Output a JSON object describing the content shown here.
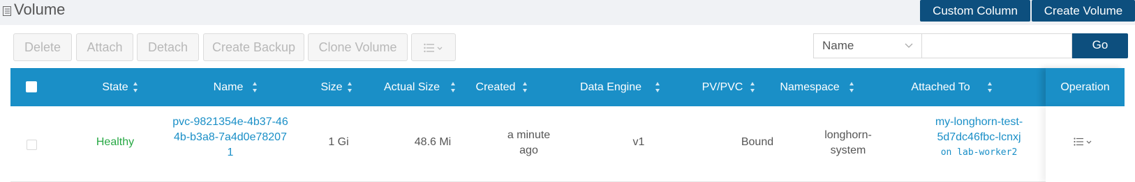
{
  "header": {
    "title": "Volume",
    "icon": "list-icon",
    "custom_column_label": "Custom Column",
    "create_volume_label": "Create Volume"
  },
  "toolbar": {
    "delete_label": "Delete",
    "attach_label": "Attach",
    "detach_label": "Detach",
    "create_backup_label": "Create Backup",
    "clone_volume_label": "Clone Volume",
    "more_icon": "list-dropdown-icon"
  },
  "filter": {
    "field_selected": "Name",
    "search_value": "",
    "go_label": "Go"
  },
  "table": {
    "columns": [
      "State",
      "Name",
      "Size",
      "Actual Size",
      "Created",
      "Data Engine",
      "PV/PVC",
      "Namespace",
      "Attached To",
      "Operation"
    ],
    "rows": [
      {
        "state": "Healthy",
        "name_lines": [
          "pvc-9821354e-4b37-46",
          "4b-b3a8-7a4d0e78207",
          "1"
        ],
        "size": "1 Gi",
        "actual_size": "48.6 Mi",
        "created_lines": [
          "a minute",
          "ago"
        ],
        "data_engine": "v1",
        "pv_pvc": "Bound",
        "namespace_lines": [
          "longhorn-",
          "system"
        ],
        "attached_to_lines": [
          "my-longhorn-test-",
          "5d7dc46fbc-lcnxj"
        ],
        "attached_node": "on lab-worker2"
      }
    ]
  },
  "colors": {
    "primary_dark": "#0d4f7e",
    "header_blue": "#1a8fc7",
    "healthy_green": "#27a844",
    "link_blue": "#1a8fc7"
  }
}
